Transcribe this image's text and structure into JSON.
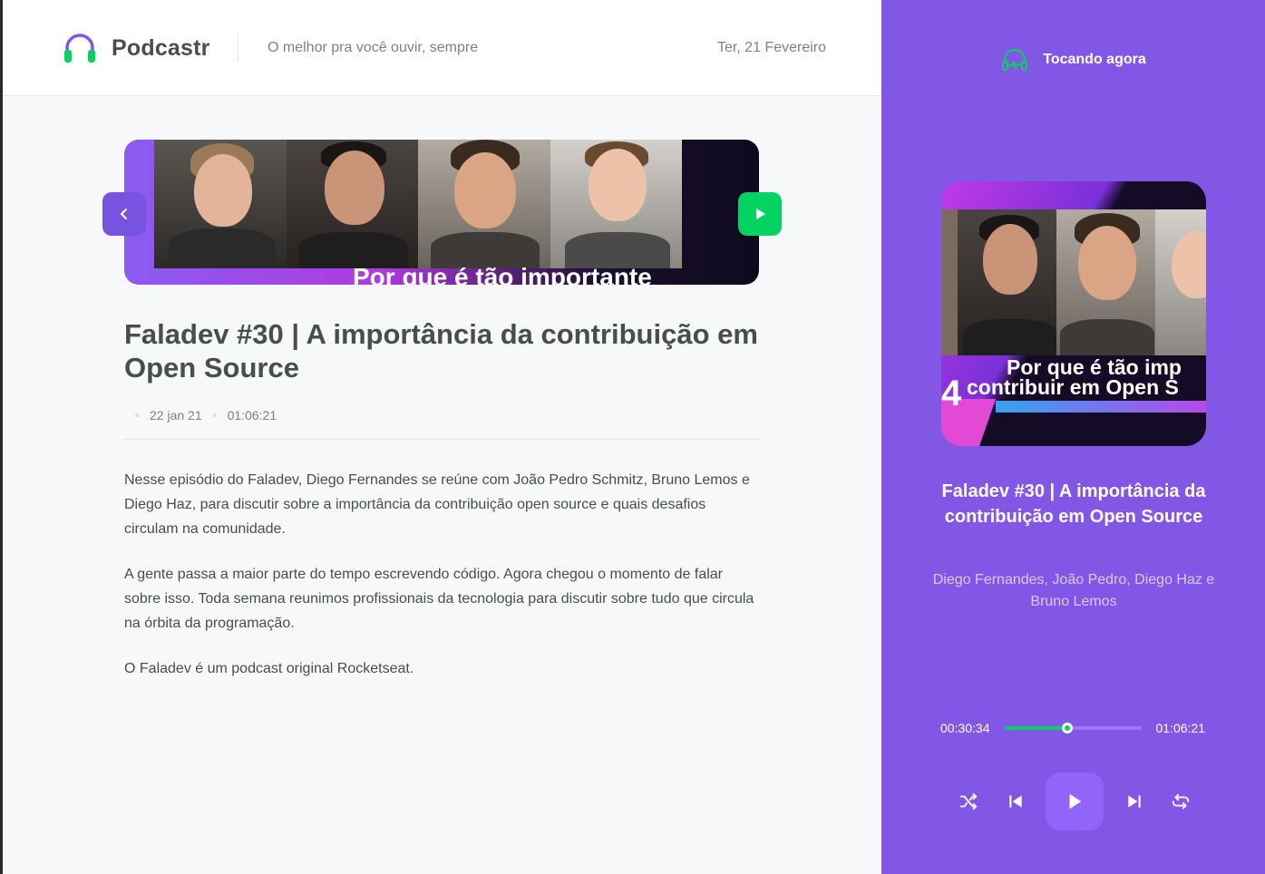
{
  "header": {
    "app_name": "Podcastr",
    "tagline": "O melhor pra você ouvir, sempre",
    "date": "Ter, 21 Fevereiro"
  },
  "episode": {
    "thumbnail_caption": "Por que é tão importante",
    "title": "Faladev #30 | A importância da contribuição em Open Source",
    "published_at": "22 jan 21",
    "duration": "01:06:21",
    "description": [
      "Nesse episódio do Faladev, Diego Fernandes se reúne com João Pedro Schmitz, Bruno Lemos e Diego Haz, para discutir sobre a importância da contribuição open source e quais desafios circulam na comunidade.",
      "A gente passa a maior parte do tempo escrevendo código. Agora chegou o momento de falar sobre isso. Toda semana reunimos profissionais da tecnologia para discutir sobre tudo que circula na órbita da programação.",
      "O Faladev é um podcast original Rocketseat."
    ]
  },
  "player": {
    "now_playing_label": "Tocando agora",
    "cover_caption_line1": "Por que é tão imp",
    "cover_caption_line2": "contribuir em Open S",
    "cover_number": "4",
    "title": "Faladev #30 | A importância da contribuição em Open Source",
    "members": "Diego Fernandes, João Pedro, Diego Haz e Bruno Lemos",
    "current_time": "00:30:34",
    "total_time": "01:06:21",
    "progress_fraction": 0.46
  },
  "icons": {
    "logo": "headphones-icon",
    "back": "chevron-left-icon",
    "play_episode": "play-icon",
    "now_playing": "headphones-pulse-icon",
    "shuffle": "shuffle-icon",
    "previous": "skip-previous-icon",
    "play": "play-icon",
    "next": "skip-next-icon",
    "repeat": "repeat-icon"
  },
  "colors": {
    "brand_purple": "#8257e5",
    "accent_green": "#04d361",
    "text_dark": "#494d4b",
    "text_muted": "#808080"
  }
}
